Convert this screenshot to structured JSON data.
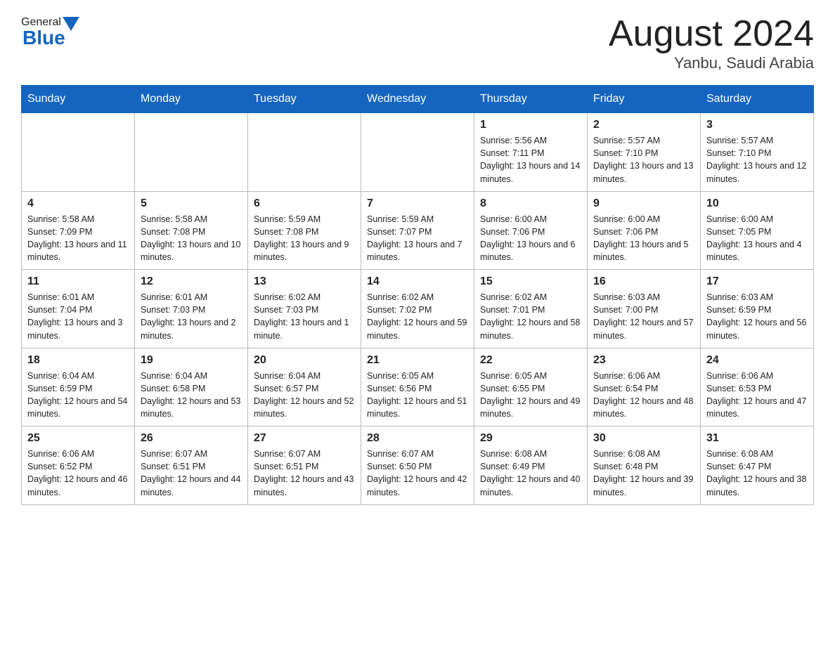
{
  "header": {
    "logo_general": "General",
    "logo_blue": "Blue",
    "title": "August 2024",
    "subtitle": "Yanbu, Saudi Arabia"
  },
  "days_of_week": [
    "Sunday",
    "Monday",
    "Tuesday",
    "Wednesday",
    "Thursday",
    "Friday",
    "Saturday"
  ],
  "weeks": [
    [
      {
        "day": "",
        "sunrise": "",
        "sunset": "",
        "daylight": ""
      },
      {
        "day": "",
        "sunrise": "",
        "sunset": "",
        "daylight": ""
      },
      {
        "day": "",
        "sunrise": "",
        "sunset": "",
        "daylight": ""
      },
      {
        "day": "",
        "sunrise": "",
        "sunset": "",
        "daylight": ""
      },
      {
        "day": "1",
        "sunrise": "Sunrise: 5:56 AM",
        "sunset": "Sunset: 7:11 PM",
        "daylight": "Daylight: 13 hours and 14 minutes."
      },
      {
        "day": "2",
        "sunrise": "Sunrise: 5:57 AM",
        "sunset": "Sunset: 7:10 PM",
        "daylight": "Daylight: 13 hours and 13 minutes."
      },
      {
        "day": "3",
        "sunrise": "Sunrise: 5:57 AM",
        "sunset": "Sunset: 7:10 PM",
        "daylight": "Daylight: 13 hours and 12 minutes."
      }
    ],
    [
      {
        "day": "4",
        "sunrise": "Sunrise: 5:58 AM",
        "sunset": "Sunset: 7:09 PM",
        "daylight": "Daylight: 13 hours and 11 minutes."
      },
      {
        "day": "5",
        "sunrise": "Sunrise: 5:58 AM",
        "sunset": "Sunset: 7:08 PM",
        "daylight": "Daylight: 13 hours and 10 minutes."
      },
      {
        "day": "6",
        "sunrise": "Sunrise: 5:59 AM",
        "sunset": "Sunset: 7:08 PM",
        "daylight": "Daylight: 13 hours and 9 minutes."
      },
      {
        "day": "7",
        "sunrise": "Sunrise: 5:59 AM",
        "sunset": "Sunset: 7:07 PM",
        "daylight": "Daylight: 13 hours and 7 minutes."
      },
      {
        "day": "8",
        "sunrise": "Sunrise: 6:00 AM",
        "sunset": "Sunset: 7:06 PM",
        "daylight": "Daylight: 13 hours and 6 minutes."
      },
      {
        "day": "9",
        "sunrise": "Sunrise: 6:00 AM",
        "sunset": "Sunset: 7:06 PM",
        "daylight": "Daylight: 13 hours and 5 minutes."
      },
      {
        "day": "10",
        "sunrise": "Sunrise: 6:00 AM",
        "sunset": "Sunset: 7:05 PM",
        "daylight": "Daylight: 13 hours and 4 minutes."
      }
    ],
    [
      {
        "day": "11",
        "sunrise": "Sunrise: 6:01 AM",
        "sunset": "Sunset: 7:04 PM",
        "daylight": "Daylight: 13 hours and 3 minutes."
      },
      {
        "day": "12",
        "sunrise": "Sunrise: 6:01 AM",
        "sunset": "Sunset: 7:03 PM",
        "daylight": "Daylight: 13 hours and 2 minutes."
      },
      {
        "day": "13",
        "sunrise": "Sunrise: 6:02 AM",
        "sunset": "Sunset: 7:03 PM",
        "daylight": "Daylight: 13 hours and 1 minute."
      },
      {
        "day": "14",
        "sunrise": "Sunrise: 6:02 AM",
        "sunset": "Sunset: 7:02 PM",
        "daylight": "Daylight: 12 hours and 59 minutes."
      },
      {
        "day": "15",
        "sunrise": "Sunrise: 6:02 AM",
        "sunset": "Sunset: 7:01 PM",
        "daylight": "Daylight: 12 hours and 58 minutes."
      },
      {
        "day": "16",
        "sunrise": "Sunrise: 6:03 AM",
        "sunset": "Sunset: 7:00 PM",
        "daylight": "Daylight: 12 hours and 57 minutes."
      },
      {
        "day": "17",
        "sunrise": "Sunrise: 6:03 AM",
        "sunset": "Sunset: 6:59 PM",
        "daylight": "Daylight: 12 hours and 56 minutes."
      }
    ],
    [
      {
        "day": "18",
        "sunrise": "Sunrise: 6:04 AM",
        "sunset": "Sunset: 6:59 PM",
        "daylight": "Daylight: 12 hours and 54 minutes."
      },
      {
        "day": "19",
        "sunrise": "Sunrise: 6:04 AM",
        "sunset": "Sunset: 6:58 PM",
        "daylight": "Daylight: 12 hours and 53 minutes."
      },
      {
        "day": "20",
        "sunrise": "Sunrise: 6:04 AM",
        "sunset": "Sunset: 6:57 PM",
        "daylight": "Daylight: 12 hours and 52 minutes."
      },
      {
        "day": "21",
        "sunrise": "Sunrise: 6:05 AM",
        "sunset": "Sunset: 6:56 PM",
        "daylight": "Daylight: 12 hours and 51 minutes."
      },
      {
        "day": "22",
        "sunrise": "Sunrise: 6:05 AM",
        "sunset": "Sunset: 6:55 PM",
        "daylight": "Daylight: 12 hours and 49 minutes."
      },
      {
        "day": "23",
        "sunrise": "Sunrise: 6:06 AM",
        "sunset": "Sunset: 6:54 PM",
        "daylight": "Daylight: 12 hours and 48 minutes."
      },
      {
        "day": "24",
        "sunrise": "Sunrise: 6:06 AM",
        "sunset": "Sunset: 6:53 PM",
        "daylight": "Daylight: 12 hours and 47 minutes."
      }
    ],
    [
      {
        "day": "25",
        "sunrise": "Sunrise: 6:06 AM",
        "sunset": "Sunset: 6:52 PM",
        "daylight": "Daylight: 12 hours and 46 minutes."
      },
      {
        "day": "26",
        "sunrise": "Sunrise: 6:07 AM",
        "sunset": "Sunset: 6:51 PM",
        "daylight": "Daylight: 12 hours and 44 minutes."
      },
      {
        "day": "27",
        "sunrise": "Sunrise: 6:07 AM",
        "sunset": "Sunset: 6:51 PM",
        "daylight": "Daylight: 12 hours and 43 minutes."
      },
      {
        "day": "28",
        "sunrise": "Sunrise: 6:07 AM",
        "sunset": "Sunset: 6:50 PM",
        "daylight": "Daylight: 12 hours and 42 minutes."
      },
      {
        "day": "29",
        "sunrise": "Sunrise: 6:08 AM",
        "sunset": "Sunset: 6:49 PM",
        "daylight": "Daylight: 12 hours and 40 minutes."
      },
      {
        "day": "30",
        "sunrise": "Sunrise: 6:08 AM",
        "sunset": "Sunset: 6:48 PM",
        "daylight": "Daylight: 12 hours and 39 minutes."
      },
      {
        "day": "31",
        "sunrise": "Sunrise: 6:08 AM",
        "sunset": "Sunset: 6:47 PM",
        "daylight": "Daylight: 12 hours and 38 minutes."
      }
    ]
  ]
}
